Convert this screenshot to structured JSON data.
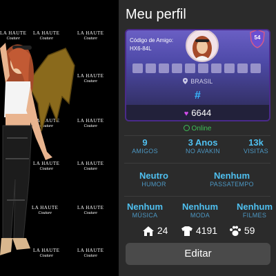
{
  "watermark": {
    "line1": "LA HAUTE",
    "line2": "Couture"
  },
  "profile": {
    "title": "Meu perfil",
    "friend_code_label": "Código de Amigo:",
    "friend_code": "HX6-84L",
    "level": "54",
    "country": "BRASIL",
    "hash": "#",
    "gems": "6644",
    "status": "Online",
    "stats": {
      "friends": {
        "value": "9",
        "label": "AMIGOS"
      },
      "years": {
        "value": "3 Anos",
        "label": "NO AVAKIN"
      },
      "visits": {
        "value": "13k",
        "label": "VISITAS"
      },
      "mood": {
        "value": "Neutro",
        "label": "HUMOR"
      },
      "hobby": {
        "value": "Nenhum",
        "label": "PASSATEMPO"
      },
      "music": {
        "value": "Nenhum",
        "label": "MÚSICA"
      },
      "fashion": {
        "value": "Nenhum",
        "label": "MODA"
      },
      "movies": {
        "value": "Nenhum",
        "label": "FILMES"
      }
    },
    "counts": {
      "homes": "24",
      "outfits": "4191",
      "pets": "59"
    },
    "edit_label": "Editar"
  },
  "colors": {
    "accent": "#4fc0f0",
    "online": "#3fbf58",
    "card": "#5a54b8",
    "panel": "#2b2b2b"
  }
}
